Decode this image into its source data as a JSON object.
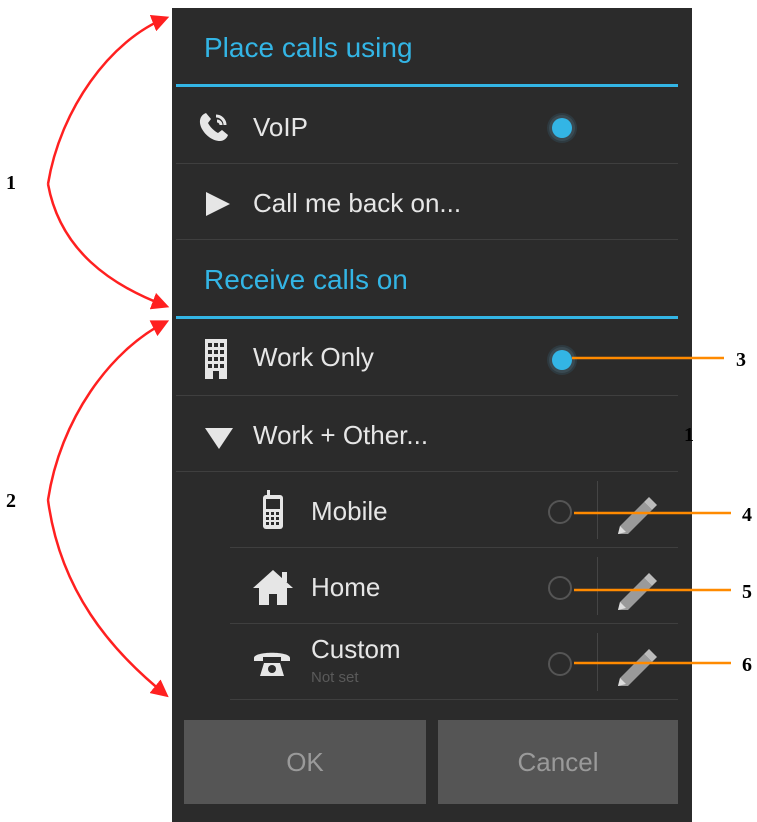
{
  "dialog": {
    "place_calls": {
      "header": "Place calls using",
      "options": [
        {
          "label": "VoIP",
          "icon": "voip-phone-icon",
          "selected": true
        },
        {
          "label": "Call me back on...",
          "icon": "expand-arrow-icon"
        }
      ]
    },
    "receive_calls": {
      "header": "Receive calls on",
      "options": [
        {
          "label": "Work Only",
          "icon": "office-building-icon",
          "selected": true
        },
        {
          "label": "Work + Other...",
          "icon": "collapse-arrow-icon"
        }
      ],
      "sub_options": [
        {
          "label": "Mobile",
          "icon": "mobile-phone-icon",
          "selected": false
        },
        {
          "label": "Home",
          "icon": "house-icon",
          "selected": false
        },
        {
          "label": "Custom",
          "sublabel": "Not set",
          "icon": "desk-phone-icon",
          "selected": false
        }
      ]
    },
    "buttons": {
      "ok": "OK",
      "cancel": "Cancel"
    }
  },
  "annotations": {
    "n1": "1",
    "n2": "2",
    "n3": "3",
    "n4": "4",
    "n5": "5",
    "n6": "6",
    "stray": "1"
  },
  "colors": {
    "accent": "#33b5e5",
    "background": "#2b2b2b",
    "button": "#555555",
    "arrow": "#ff2020",
    "callout": "#ff8a00"
  }
}
